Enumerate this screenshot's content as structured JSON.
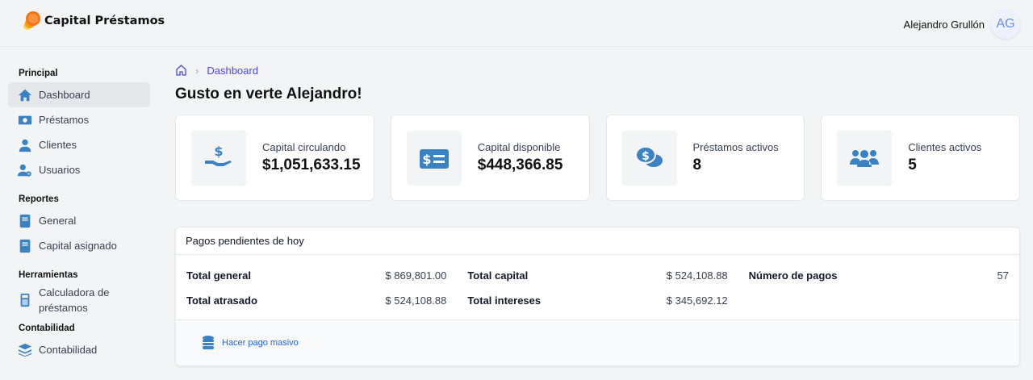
{
  "header": {
    "app_name": "Capital Préstamos",
    "user_name": "Alejandro Grullón",
    "avatar_initials": "AG"
  },
  "sidebar": {
    "sections": [
      {
        "title": "Principal",
        "items": [
          {
            "label": "Dashboard",
            "icon": "home-icon"
          },
          {
            "label": "Préstamos",
            "icon": "money-bill-icon"
          },
          {
            "label": "Clientes",
            "icon": "user-icon"
          },
          {
            "label": "Usuarios",
            "icon": "user-gear-icon"
          }
        ]
      },
      {
        "title": "Reportes",
        "items": [
          {
            "label": "General",
            "icon": "book-icon"
          },
          {
            "label": "Capital asignado",
            "icon": "book-icon"
          }
        ]
      },
      {
        "title": "Herramientas",
        "items": [
          {
            "label": "Calculadora de préstamos",
            "icon": "calculator-icon"
          }
        ]
      },
      {
        "title": "Contabilidad",
        "items": [
          {
            "label": "Contabilidad",
            "icon": "layers-icon"
          }
        ]
      }
    ]
  },
  "breadcrumb": {
    "current": "Dashboard"
  },
  "greeting": "Gusto en verte Alejandro!",
  "cards": [
    {
      "label": "Capital circulando",
      "value": "$1,051,633.15"
    },
    {
      "label": "Capital disponible",
      "value": "$448,366.85"
    },
    {
      "label": "Préstamos activos",
      "value": "8"
    },
    {
      "label": "Clientes activos",
      "value": "5"
    }
  ],
  "payments": {
    "title": "Pagos pendientes de hoy",
    "rows": [
      {
        "label": "Total general",
        "value": "$ 869,801.00"
      },
      {
        "label": "Total capital",
        "value": "$ 524,108.88"
      },
      {
        "label": "Número de pagos",
        "value": "57"
      },
      {
        "label": "Total atrasado",
        "value": "$ 524,108.88"
      },
      {
        "label": "Total intereses",
        "value": "$ 345,692.12"
      }
    ],
    "action": "Hacer pago masivo"
  },
  "colors": {
    "accent": "#3b82c4",
    "link": "#4f46e5"
  }
}
